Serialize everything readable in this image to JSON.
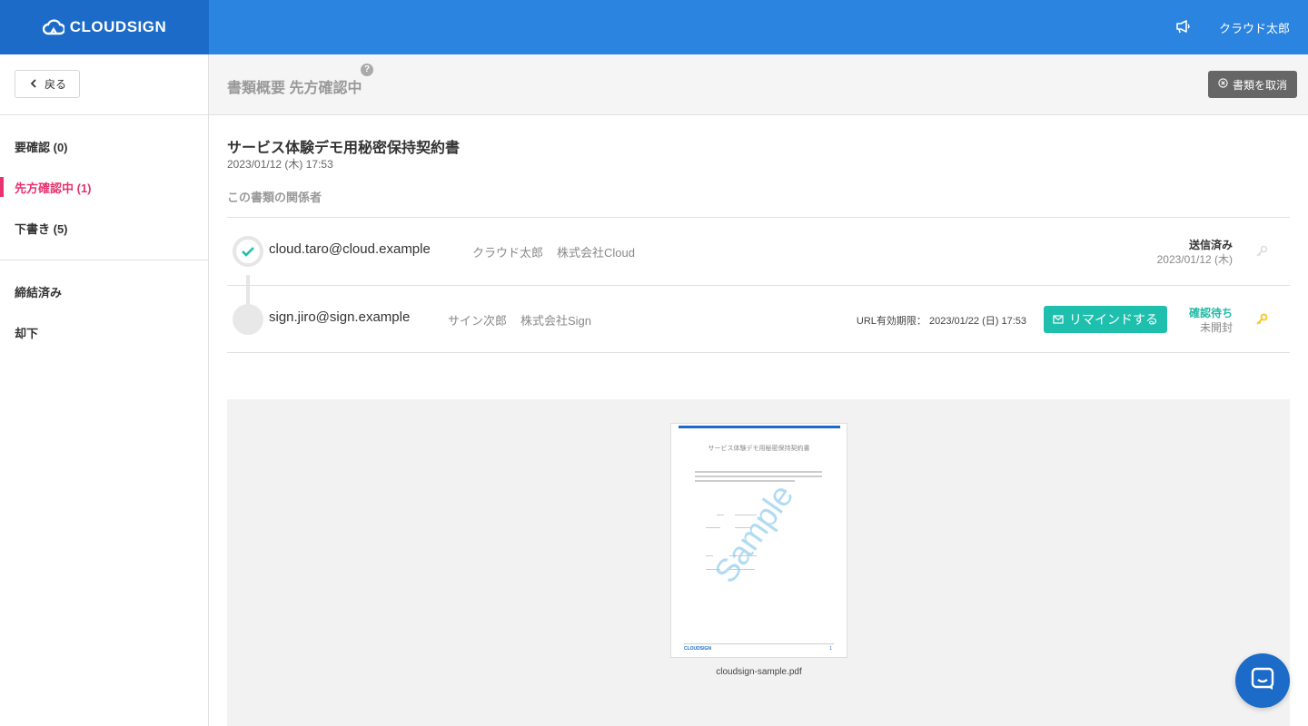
{
  "header": {
    "logo_text": "CLOUDSIGN",
    "user_name": "クラウド太郎",
    "icon": "megaphone-icon"
  },
  "sidebar": {
    "back_label": "戻る",
    "items": [
      {
        "label": "要確認 (0)"
      },
      {
        "label": "先方確認中 (1)",
        "active": true
      },
      {
        "label": "下書き (5)"
      },
      {
        "label": "締結済み"
      },
      {
        "label": "却下"
      }
    ]
  },
  "subheader": {
    "title": "書類概要 先方確認中",
    "help": "?",
    "cancel_label": "書類を取消"
  },
  "document": {
    "title": "サービス体験デモ用秘密保持契約書",
    "date": "2023/01/12 (木) 17:53",
    "parties_heading": "この書類の関係者"
  },
  "parties": [
    {
      "email": "cloud.taro@cloud.example",
      "name": "クラウド太郎",
      "company": "株式会社Cloud",
      "status": "送信済み",
      "status_sub": "2023/01/12 (木)"
    },
    {
      "email": "sign.jiro@sign.example",
      "name": "サイン次郎",
      "company": "株式会社Sign",
      "url_expiry_label": "URL有効期限：",
      "url_expiry_value": "2023/01/22 (日) 17:53",
      "remind_label": "リマインドする",
      "status": "確認待ち",
      "status_sub": "未開封"
    }
  ],
  "preview": {
    "thumb_title": "サービス体験デモ用秘密保持契約書",
    "watermark": "Sample",
    "thumb_logo": "CLOUDSIGN",
    "thumb_page": "1",
    "file_name": "cloudsign-sample.pdf"
  },
  "colors": {
    "header_bg": "#2a84e0",
    "logo_bg": "#1c6bc9",
    "active_nav": "#e8336e",
    "teal": "#1fbfae",
    "key_active": "#f5c518"
  }
}
